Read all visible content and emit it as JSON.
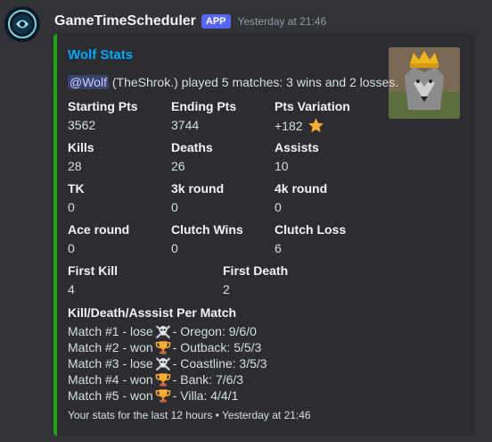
{
  "message": {
    "author": "GameTimeScheduler",
    "badge": "APP",
    "timestamp": "Yesterday at 21:46"
  },
  "embed": {
    "accent_color": "#1fa313",
    "title": "Wolf Stats",
    "description": {
      "mention": "@Wolf",
      "text": " (TheShrok.) played 5 matches: 3 wins and 2 losses."
    },
    "fields": {
      "starting_pts": {
        "name": "Starting Pts",
        "value": "3562"
      },
      "ending_pts": {
        "name": "Ending Pts",
        "value": "3744"
      },
      "pts_variation": {
        "name": "Pts Variation",
        "value": "+182",
        "icon": "star-icon"
      },
      "kills": {
        "name": "Kills",
        "value": "28"
      },
      "deaths": {
        "name": "Deaths",
        "value": "26"
      },
      "assists": {
        "name": "Assists",
        "value": "10"
      },
      "tk": {
        "name": "TK",
        "value": "0"
      },
      "round_3k": {
        "name": "3k round",
        "value": "0"
      },
      "round_4k": {
        "name": "4k round",
        "value": "0"
      },
      "ace_round": {
        "name": "Ace round",
        "value": "0"
      },
      "clutch_wins": {
        "name": "Clutch Wins",
        "value": "0"
      },
      "clutch_loss": {
        "name": "Clutch Loss",
        "value": "6"
      },
      "first_kill": {
        "name": "First Kill",
        "value": "4"
      },
      "first_death": {
        "name": "First Death",
        "value": "2"
      }
    },
    "kda": {
      "name": "Kill/Death/Asssist Per Match",
      "matches": [
        {
          "prefix": "Match #1 - lose",
          "icon": "skull-crossbones-icon",
          "suffix": "- Oregon: 9/6/0"
        },
        {
          "prefix": "Match #2 - won",
          "icon": "trophy-icon",
          "suffix": "- Outback: 5/5/3"
        },
        {
          "prefix": "Match #3 - lose",
          "icon": "skull-crossbones-icon",
          "suffix": "- Coastline: 3/5/3"
        },
        {
          "prefix": "Match #4 - won",
          "icon": "trophy-icon",
          "suffix": "- Bank: 7/6/3"
        },
        {
          "prefix": "Match #5 - won",
          "icon": "trophy-icon",
          "suffix": "- Villa: 4/4/1"
        }
      ]
    },
    "footer": "Your stats for the last 12 hours • Yesterday at 21:46"
  }
}
